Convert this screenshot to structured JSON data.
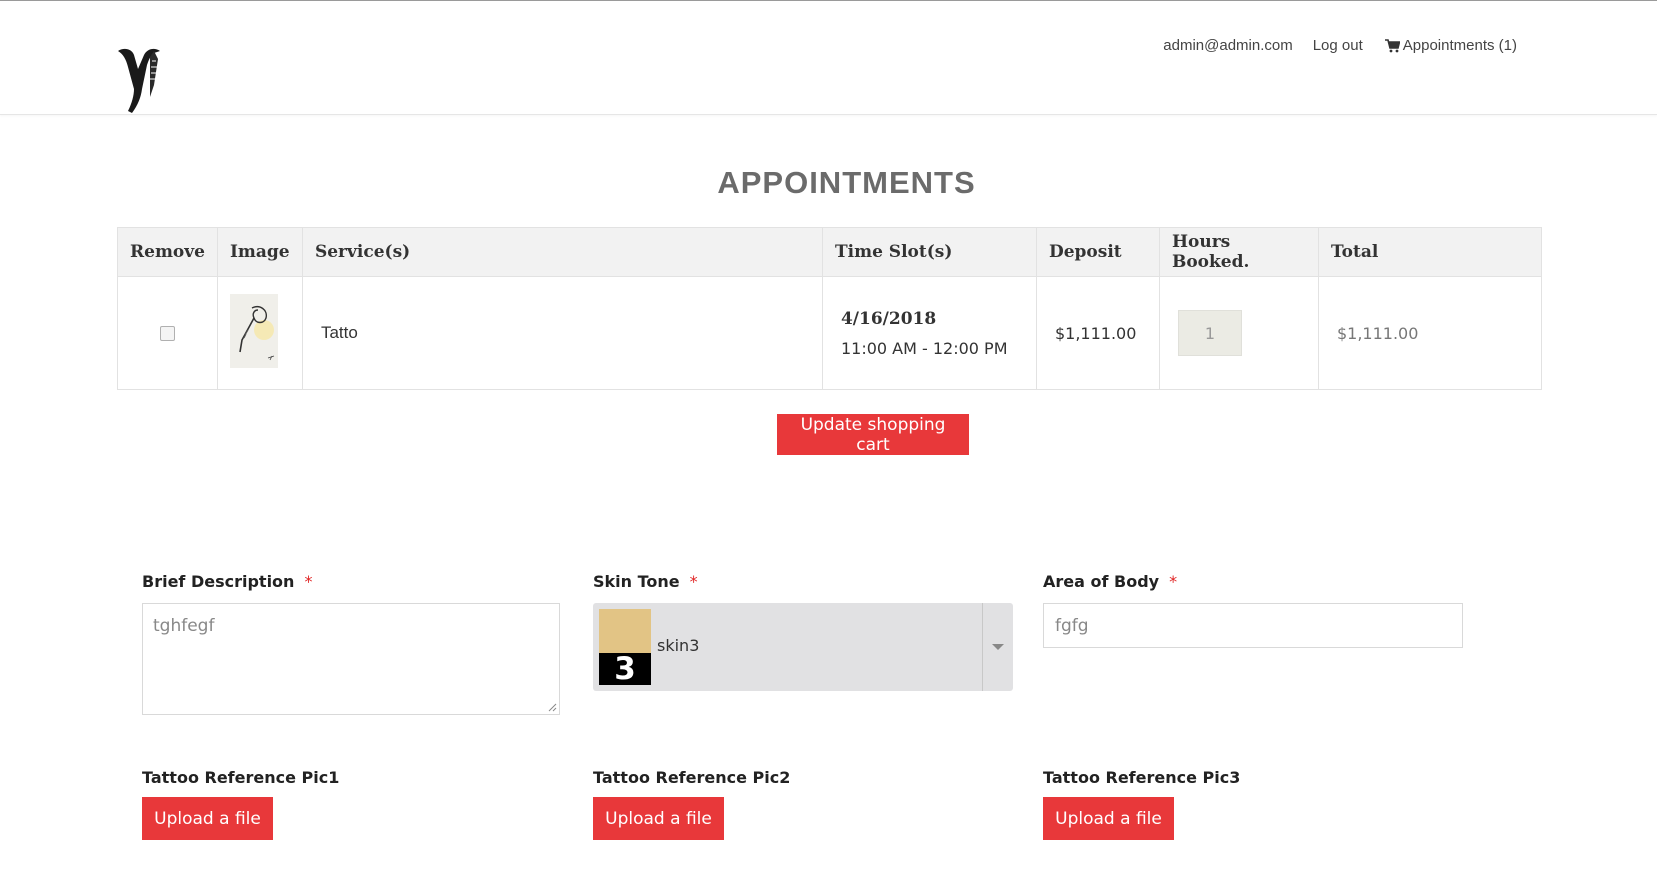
{
  "header": {
    "email": "admin@admin.com",
    "logout": "Log out",
    "cart_label": "Appointments (1)"
  },
  "page_title": "APPOINTMENTS",
  "table": {
    "headers": [
      "Remove",
      "Image",
      "Service(s)",
      "Time Slot(s)",
      "Deposit",
      "Hours Booked.",
      "Total"
    ],
    "rows": [
      {
        "service": "Tatto",
        "date": "4/16/2018",
        "time": "11:00 AM - 12:00 PM",
        "deposit": "$1,111.00",
        "hours": "1",
        "total": "$1,111.00"
      }
    ]
  },
  "update_button": "Update shopping cart",
  "form": {
    "description_label": "Brief Description",
    "description_value": "tghfegf",
    "skin_label": "Skin Tone",
    "skin_value": "skin3",
    "skin_number": "3",
    "skin_color": "#e2c485",
    "area_label": "Area of Body",
    "area_value": "fgfg",
    "required_mark": "*",
    "pic1_label": "Tattoo Reference Pic1",
    "pic2_label": "Tattoo Reference Pic2",
    "pic3_label": "Tattoo Reference Pic3",
    "upload_label": "Upload a file"
  },
  "colors": {
    "accent": "#e8383a",
    "required": "#e02424"
  }
}
